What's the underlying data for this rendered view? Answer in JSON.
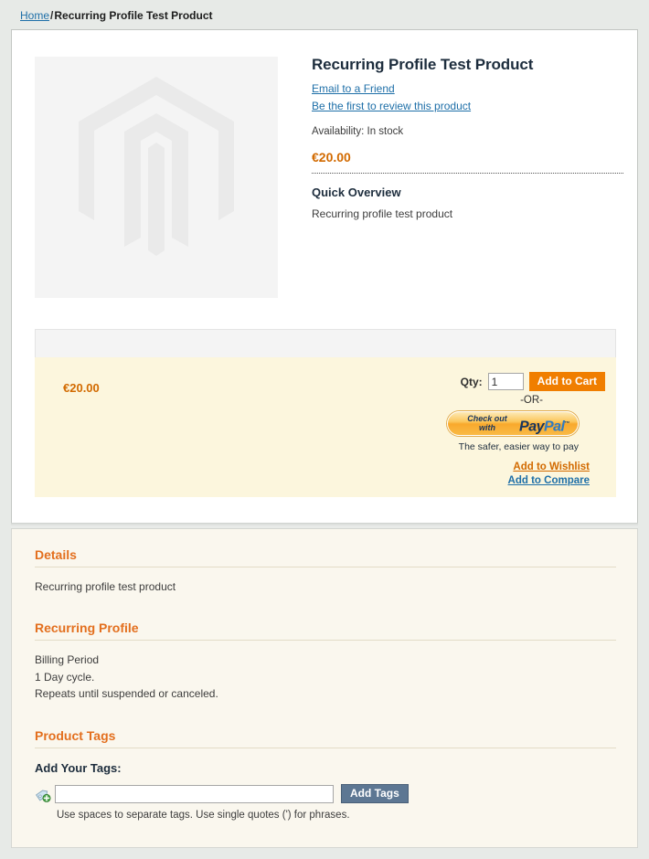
{
  "breadcrumb": {
    "home_label": "Home",
    "separator": "/",
    "current_label": "Recurring Profile Test Product"
  },
  "product": {
    "name": "Recurring Profile Test Product",
    "email_friend_label": "Email to a Friend",
    "review_label": "Be the first to review this product",
    "availability": "Availability: In stock",
    "price": "€20.00",
    "overview_title": "Quick Overview",
    "overview_text": "Recurring profile test product",
    "image_alt": "magento-placeholder-logo"
  },
  "cart": {
    "price": "€20.00",
    "qty_label": "Qty:",
    "qty_value": "1",
    "add_to_cart_label": "Add to Cart",
    "or_label": "-OR-",
    "paypal": {
      "checkout_line1": "Check out",
      "checkout_line2": "with",
      "logo_pay": "Pay",
      "logo_pal": "Pal",
      "trademark": "™",
      "tagline": "The safer, easier way to pay"
    },
    "wishlist_label": "Add to Wishlist",
    "compare_label": "Add to Compare"
  },
  "sections": {
    "details": {
      "title": "Details",
      "body": "Recurring profile test product"
    },
    "recurring": {
      "title": "Recurring Profile",
      "line1": "Billing Period",
      "line2": "1 Day cycle.",
      "line3": "Repeats until suspended or canceled."
    },
    "tags": {
      "title": "Product Tags",
      "add_label": "Add Your Tags:",
      "input_value": "",
      "input_placeholder": "",
      "button_label": "Add Tags",
      "hint": "Use spaces to separate tags. Use single quotes (') for phrases.",
      "icon": "tag-add-icon"
    }
  },
  "colors": {
    "page_background": "#e7eae7",
    "accent_orange": "#e36f1e",
    "price_orange": "#d26a00",
    "link_blue": "#1e6fa8",
    "cart_yellow": "#fcf6dd",
    "panel_cream": "#faf7ee",
    "button_orange": "#f07e00",
    "button_slate": "#5d7793"
  }
}
